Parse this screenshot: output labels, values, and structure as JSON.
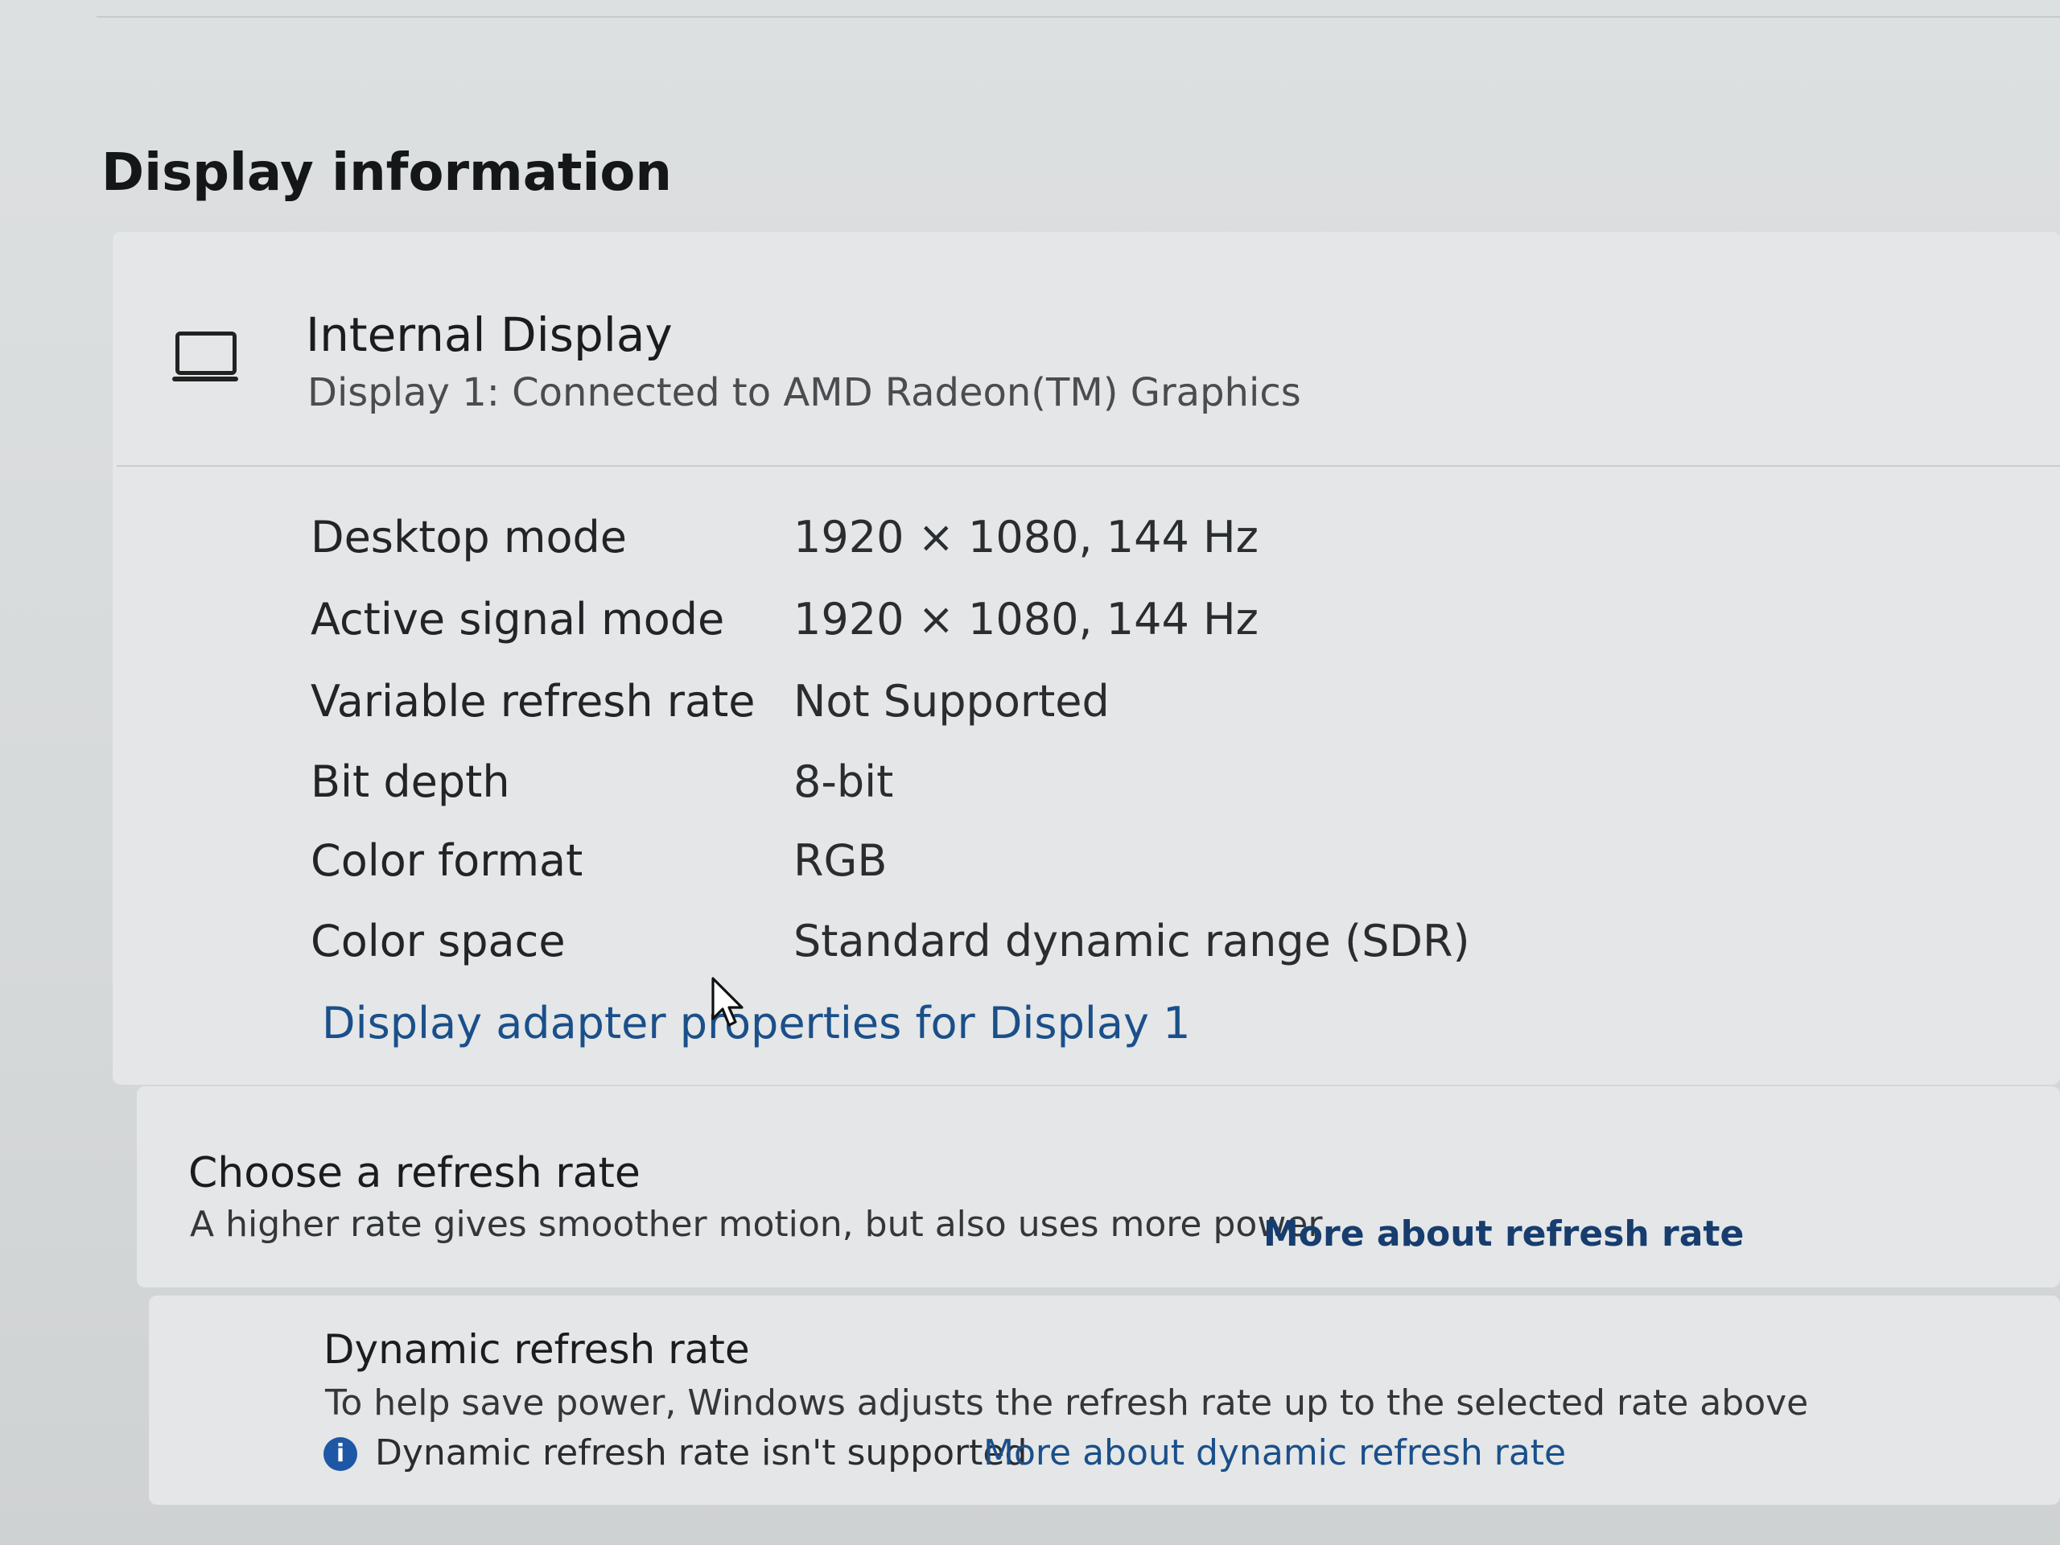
{
  "section": {
    "title": "Display information"
  },
  "display": {
    "icon": "laptop-icon",
    "name": "Internal Display",
    "subtitle": "Display 1: Connected to AMD Radeon(TM) Graphics"
  },
  "info_rows": [
    {
      "label": "Desktop mode",
      "value": "1920 × 1080, 144 Hz"
    },
    {
      "label": "Active signal mode",
      "value": "1920 × 1080, 144 Hz"
    },
    {
      "label": "Variable refresh rate",
      "value": "Not Supported"
    },
    {
      "label": "Bit depth",
      "value": "8-bit"
    },
    {
      "label": "Color format",
      "value": "RGB"
    },
    {
      "label": "Color space",
      "value": "Standard dynamic range (SDR)"
    }
  ],
  "adapter_link": "Display adapter properties for Display 1",
  "refresh": {
    "title": "Choose a refresh rate",
    "description": "A higher rate gives smoother motion, but also uses more power",
    "link": "More about refresh rate"
  },
  "dynamic": {
    "title": "Dynamic refresh rate",
    "description": "To help save power, Windows adjusts the refresh rate up to the selected rate above",
    "note_icon": "info-icon",
    "note": "Dynamic refresh rate isn't supported",
    "link": "More about dynamic refresh rate"
  },
  "colors": {
    "link": "#1a4f8a",
    "info_badge": "#1d57a5"
  }
}
